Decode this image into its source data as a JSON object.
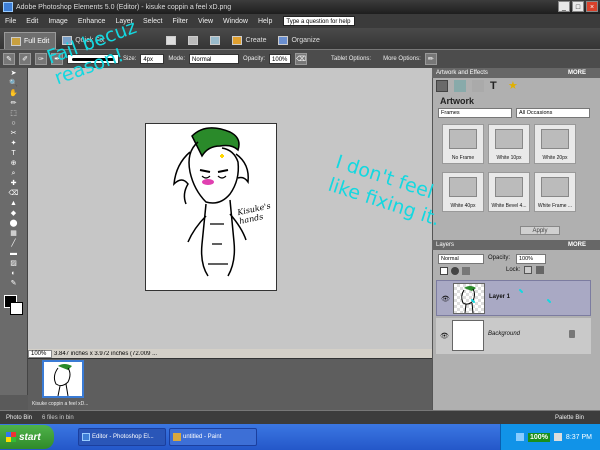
{
  "window": {
    "title": "Adobe Photoshop Elements 5.0 (Editor) - kisuke coppin a feel xD.png",
    "buttons": [
      "_",
      "□",
      "×"
    ]
  },
  "menu": {
    "items": [
      "File",
      "Edit",
      "Image",
      "Enhance",
      "Layer",
      "Select",
      "Filter",
      "View",
      "Window",
      "Help"
    ],
    "help_search": "Type a question for help"
  },
  "modes": {
    "full_edit": "Full Edit",
    "quick_fix": "Quick Fix",
    "create": "Create",
    "organize": "Organize"
  },
  "options": {
    "size_label": "Size:",
    "size_value": "4px",
    "mode_label": "Mode:",
    "mode_value": "Normal",
    "opacity_label": "Opacity:",
    "opacity_value": "100%",
    "tablet": "Tablet Options:",
    "more_options": "More Options:"
  },
  "tools": [
    "➤",
    "🔍",
    "✋",
    "✏",
    "⬚",
    "○",
    "✂",
    "✦",
    "T",
    "⊕",
    "⌕",
    "✚",
    "⌫",
    "▲",
    "◆",
    "⬤",
    "▦",
    "╱",
    "▬",
    "▨",
    "◐",
    "✎"
  ],
  "status": {
    "zoom": "100%",
    "doc_info": "3.847 inches x 3.972 inches (72.009 ..."
  },
  "photo_bin": {
    "caption": "Kisuke coppin a feel xD...",
    "label": "Photo Bin",
    "count": "6 files in bin",
    "palette_bin": "Palette Bin"
  },
  "artwork_panel": {
    "header": "Artwork and Effects",
    "more": "MORE",
    "title": "Artwork",
    "category": "Frames",
    "filter": "All Occasions",
    "items": [
      "No Frame",
      "White 10px",
      "White 20px",
      "White 40px",
      "White Bevel 4...",
      "White Frame ..."
    ],
    "apply": "Apply"
  },
  "layers_panel": {
    "header": "Layers",
    "more": "MORE",
    "blend": "Normal",
    "opacity_label": "Opacity:",
    "opacity_value": "100%",
    "lock_label": "Lock:",
    "layers": [
      {
        "name": "Layer 1"
      },
      {
        "name": "Background"
      }
    ]
  },
  "annotations": {
    "left": "Fail becuz reason!",
    "right": "I don't feel like fixing it.",
    "canvas_text": "Kisuke's hands"
  },
  "taskbar": {
    "start": "start",
    "tasks": [
      "Editor - Photoshop El...",
      "untitled - Paint"
    ],
    "battery": "100%",
    "clock": "8:37 PM"
  }
}
